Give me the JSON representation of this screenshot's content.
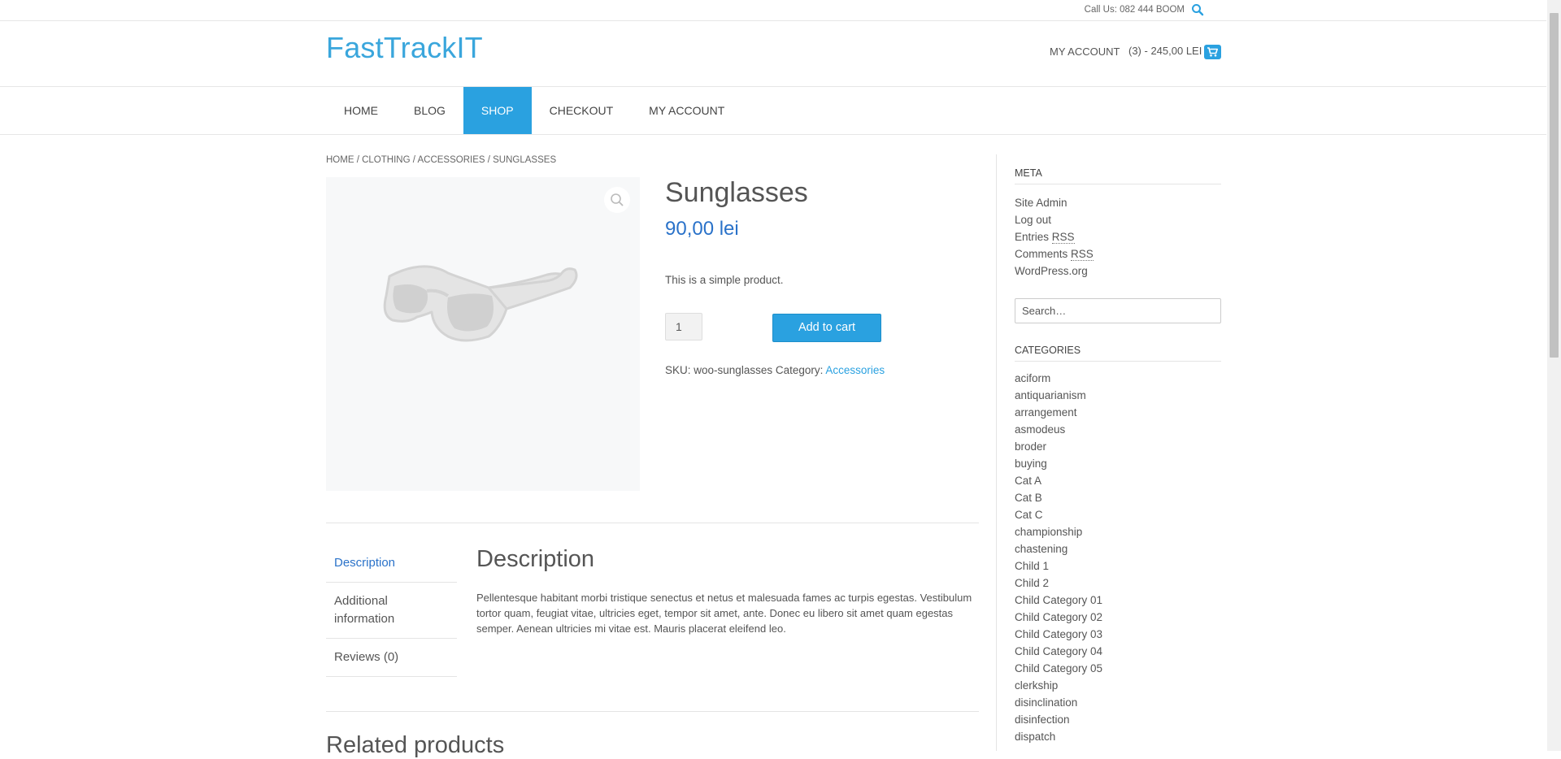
{
  "topbar": {
    "call": "Call Us: 082 444 BOOM",
    "search_icon": "search-icon"
  },
  "header": {
    "logo": "FastTrackIT",
    "my_account": "MY ACCOUNT",
    "cart": "(3) - 245,00 LEI",
    "cart_icon": "cart-icon"
  },
  "nav": {
    "items": [
      {
        "label": "HOME"
      },
      {
        "label": "BLOG"
      },
      {
        "label": "SHOP",
        "active": true
      },
      {
        "label": "CHECKOUT"
      },
      {
        "label": "MY ACCOUNT"
      }
    ]
  },
  "breadcrumb": {
    "items": [
      "HOME",
      "CLOTHING",
      "ACCESSORIES",
      "SUNGLASSES"
    ],
    "separator": " / "
  },
  "product": {
    "title": "Sunglasses",
    "price": "90,00 lei",
    "short_description": "This is a simple product.",
    "quantity": "1",
    "add_to_cart": "Add to cart",
    "sku_label": "SKU:",
    "sku": "woo-sunglasses",
    "category_label": "Category:",
    "category": "Accessories",
    "zoom_icon": "magnifier-icon"
  },
  "tabs": {
    "items": [
      {
        "label": "Description",
        "active": true
      },
      {
        "label": "Additional information"
      },
      {
        "label": "Reviews (0)"
      }
    ],
    "panel_title": "Description",
    "panel_text": "Pellentesque habitant morbi tristique senectus et netus et malesuada fames ac turpis egestas. Vestibulum tortor quam, feugiat vitae, ultricies eget, tempor sit amet, ante. Donec eu libero sit amet quam egestas semper. Aenean ultricies mi vitae est. Mauris placerat eleifend leo."
  },
  "related": {
    "title": "Related products"
  },
  "sidebar": {
    "meta_title": "META",
    "meta_links": [
      {
        "text": "Site Admin"
      },
      {
        "text": "Log out"
      },
      {
        "pre": "Entries ",
        "abbr": "RSS"
      },
      {
        "pre": "Comments ",
        "abbr": "RSS"
      },
      {
        "text": "WordPress.org"
      }
    ],
    "search_placeholder": "Search…",
    "categories_title": "CATEGORIES",
    "categories": [
      "aciform",
      "antiquarianism",
      "arrangement",
      "asmodeus",
      "broder",
      "buying",
      "Cat A",
      "Cat B",
      "Cat C",
      "championship",
      "chastening",
      "Child 1",
      "Child 2",
      "Child Category 01",
      "Child Category 02",
      "Child Category 03",
      "Child Category 04",
      "Child Category 05",
      "clerkship",
      "disinclination",
      "disinfection",
      "dispatch"
    ]
  },
  "colors": {
    "accent": "#2aa1e0",
    "logo": "#3aa6dc",
    "price": "#2a72c9"
  }
}
